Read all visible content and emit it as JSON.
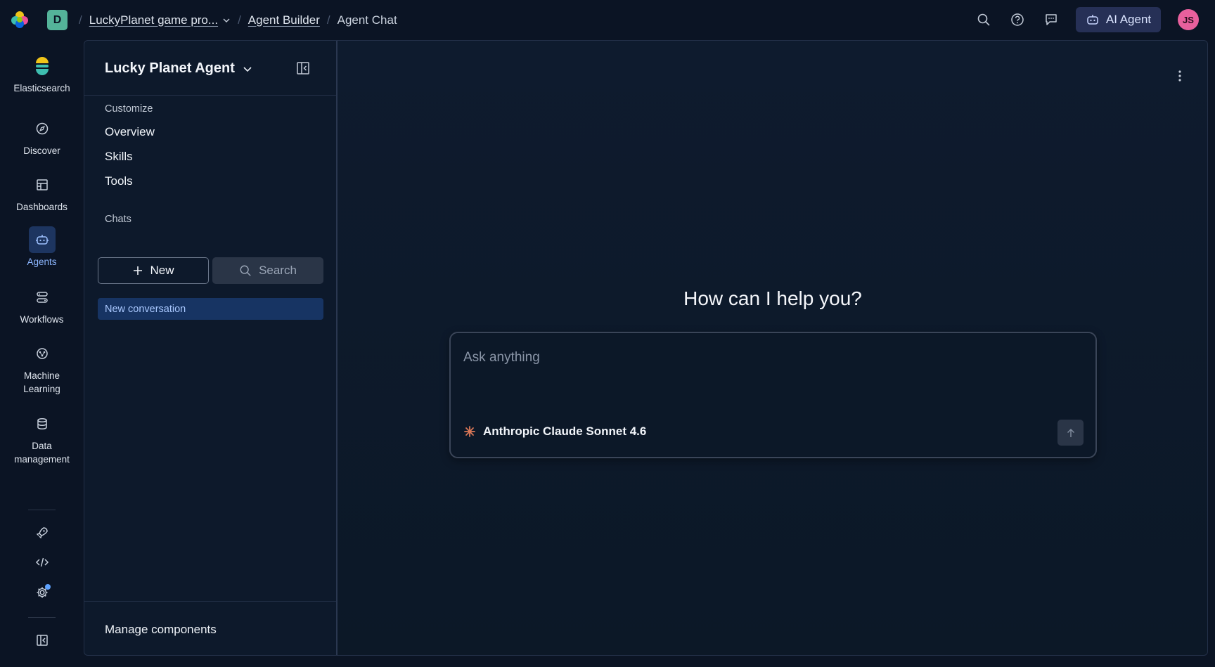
{
  "topbar": {
    "space_initial": "D",
    "breadcrumbs": [
      {
        "label": "LuckyPlanet game pro..."
      },
      {
        "label": "Agent Builder"
      },
      {
        "label": "Agent Chat"
      }
    ],
    "ai_agent_label": "AI Agent",
    "user_initials": "JS"
  },
  "leftnav": {
    "items": [
      {
        "label": "Elasticsearch",
        "icon": "elasticsearch-icon"
      },
      {
        "label": "Discover",
        "icon": "compass-icon"
      },
      {
        "label": "Dashboards",
        "icon": "dashboard-icon"
      },
      {
        "label": "Agents",
        "icon": "robot-icon"
      },
      {
        "label": "Workflows",
        "icon": "workflow-icon"
      },
      {
        "label": "Machine Learning",
        "icon": "brain-icon"
      },
      {
        "label": "Data management",
        "icon": "database-icon"
      }
    ]
  },
  "panel": {
    "agent_name": "Lucky Planet Agent",
    "customize_label": "Customize",
    "customize_items": [
      "Overview",
      "Skills",
      "Tools"
    ],
    "chats_label": "Chats",
    "new_label": "New",
    "search_label": "Search",
    "conversations": [
      "New conversation"
    ],
    "manage_label": "Manage components"
  },
  "main": {
    "greeting": "How can I help you?",
    "input_placeholder": "Ask anything",
    "model_name": "Anthropic Claude Sonnet 4.6"
  },
  "colors": {
    "accent": "#1d3560",
    "active_text": "#8cb6ff",
    "space_badge": "#54b399",
    "avatar": "#e8609d",
    "claude_brand": "#d97757"
  }
}
